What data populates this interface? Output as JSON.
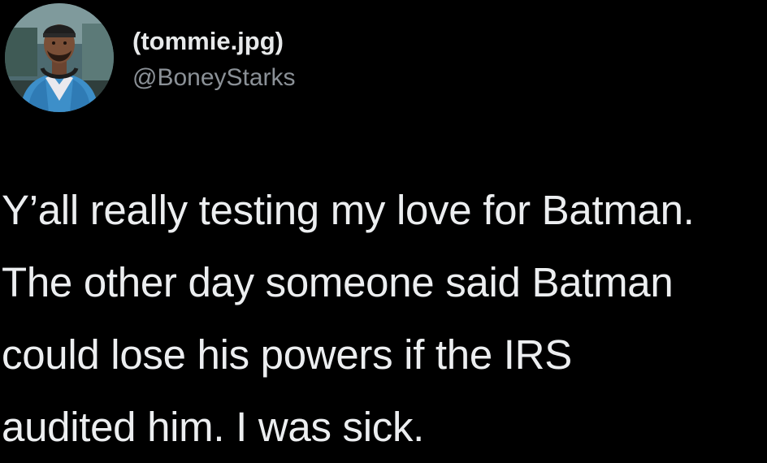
{
  "author": {
    "display_name": "(tommie.jpg)",
    "handle": "@BoneyStarks",
    "avatar_icon": "profile-photo"
  },
  "tweet": {
    "lines": [
      "Y’all really testing my love for Batman.",
      "The other day someone said Batman",
      "could lose his powers if the IRS",
      "audited him. I was sick."
    ]
  },
  "colors": {
    "background": "#000000",
    "name_text": "#e7e9ea",
    "handle_text": "#8b9197",
    "body_text": "#eceef0"
  }
}
